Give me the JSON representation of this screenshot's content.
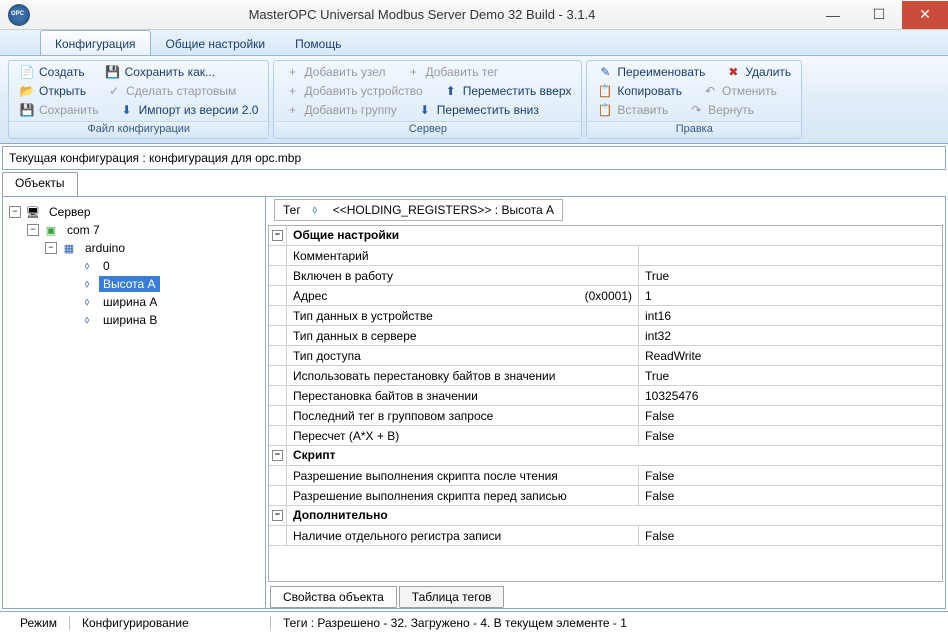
{
  "window": {
    "title": "MasterOPC Universal Modbus Server Demo 32 Build - 3.1.4"
  },
  "menu": {
    "tabs": [
      "Конфигурация",
      "Общие настройки",
      "Помощь"
    ]
  },
  "ribbon": {
    "groups": [
      {
        "label": "Файл конфигурации",
        "rows": [
          [
            {
              "icon": "📄",
              "t": "Создать",
              "cls": "c-blue"
            },
            {
              "icon": "💾",
              "t": "Сохранить как...",
              "cls": "c-blue"
            }
          ],
          [
            {
              "icon": "📂",
              "t": "Открыть",
              "cls": "c-orange"
            },
            {
              "icon": "✓",
              "t": "Сделать стартовым",
              "cls": "c-gray",
              "disabled": true
            }
          ],
          [
            {
              "icon": "💾",
              "t": "Сохранить",
              "cls": "c-gray",
              "disabled": true
            },
            {
              "icon": "⬇",
              "t": "Импорт из версии 2.0",
              "cls": "c-blue"
            }
          ]
        ]
      },
      {
        "label": "Сервер",
        "rows": [
          [
            {
              "icon": "+",
              "t": "Добавить узел",
              "cls": "c-gray",
              "disabled": true
            },
            {
              "icon": "+",
              "t": "Добавить тег",
              "cls": "c-gray",
              "disabled": true
            }
          ],
          [
            {
              "icon": "+",
              "t": "Добавить устройство",
              "cls": "c-gray",
              "disabled": true
            },
            {
              "icon": "⬆",
              "t": "Переместить вверх",
              "cls": "c-blue"
            }
          ],
          [
            {
              "icon": "+",
              "t": "Добавить группу",
              "cls": "c-gray",
              "disabled": true
            },
            {
              "icon": "⬇",
              "t": "Переместить вниз",
              "cls": "c-blue"
            }
          ]
        ]
      },
      {
        "label": "Правка",
        "rows": [
          [
            {
              "icon": "✎",
              "t": "Переименовать",
              "cls": "c-blue"
            },
            {
              "icon": "✖",
              "t": "Удалить",
              "cls": "c-red"
            }
          ],
          [
            {
              "icon": "📋",
              "t": "Копировать",
              "cls": "c-green"
            },
            {
              "icon": "↶",
              "t": "Отменить",
              "cls": "c-gray",
              "disabled": true
            }
          ],
          [
            {
              "icon": "📋",
              "t": "Вставить",
              "cls": "c-gray",
              "disabled": true
            },
            {
              "icon": "↷",
              "t": "Вернуть",
              "cls": "c-gray",
              "disabled": true
            }
          ]
        ]
      }
    ]
  },
  "configBar": {
    "text": "Текущая конфигурация : конфигурация для opc.mbp"
  },
  "objectsTab": "Объекты",
  "tree": {
    "root": "Сервер",
    "l1": "com 7",
    "l2": "arduino",
    "tags": [
      "0",
      "Высота А",
      "ширина А",
      "ширина В"
    ],
    "selectedIndex": 1
  },
  "detail": {
    "headerPrefix": "Тег",
    "headerPath": "<<HOLDING_REGISTERS>> : Высота А",
    "groups": [
      {
        "name": "Общие настройки",
        "rows": [
          {
            "k": "Комментарий",
            "v": ""
          },
          {
            "k": "Включен в работу",
            "v": "True"
          },
          {
            "k": "Адрес",
            "hint": "(0x0001)",
            "v": "1"
          },
          {
            "k": "Тип данных в устройстве",
            "v": "int16"
          },
          {
            "k": "Тип данных в сервере",
            "v": "int32"
          },
          {
            "k": "Тип доступа",
            "v": "ReadWrite"
          },
          {
            "k": "Использовать перестановку байтов в значении",
            "v": "True"
          },
          {
            "k": "Перестановка байтов в значении",
            "v": "10325476"
          },
          {
            "k": "Последний тег в групповом запросе",
            "v": "False"
          },
          {
            "k": "Пересчет (A*X + B)",
            "v": "False"
          }
        ]
      },
      {
        "name": "Скрипт",
        "rows": [
          {
            "k": "Разрешение выполнения скрипта после чтения",
            "v": "False"
          },
          {
            "k": "Разрешение выполнения скрипта перед записью",
            "v": "False"
          }
        ]
      },
      {
        "name": "Дополнительно",
        "rows": [
          {
            "k": "Наличие отдельного регистра записи",
            "v": "False"
          }
        ]
      }
    ],
    "bottomTabs": [
      "Свойства объекта",
      "Таблица тегов"
    ]
  },
  "status": {
    "modeLabel": "Режим",
    "modeValue": "Конфигурирование",
    "tags": "Теги : Разрешено - 32. Загружено - 4. В текущем элементе - 1"
  }
}
